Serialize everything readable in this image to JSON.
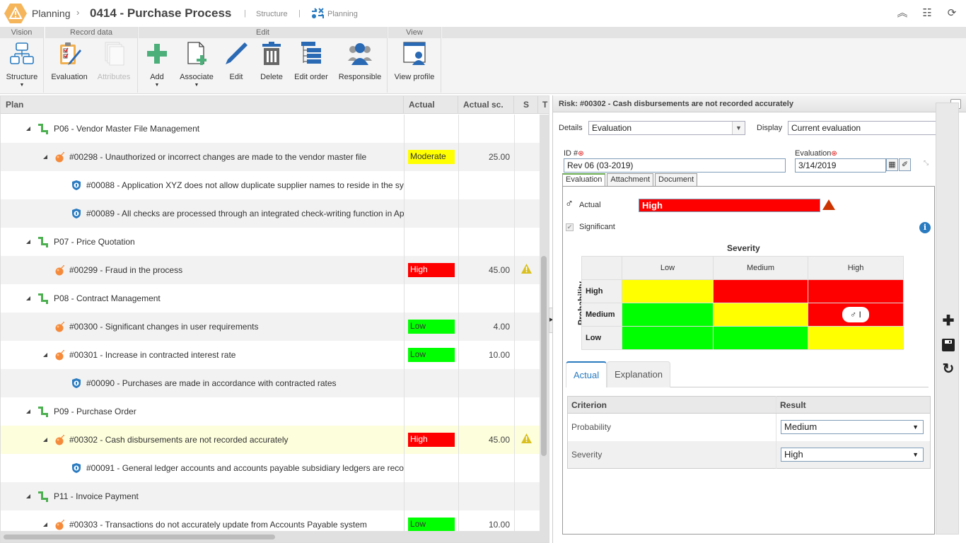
{
  "titlebar": {
    "breadcrumb_root": "Planning",
    "breadcrumb_sep": "›",
    "title": "0414 - Purchase Process",
    "nav_structure": "Structure",
    "nav_planning": "Planning",
    "pipe": "|",
    "right_icons": [
      "collapse-up-icon",
      "list-icon",
      "refresh-icon"
    ]
  },
  "ribbon": {
    "groups": [
      {
        "title": "Vision",
        "buttons": [
          {
            "label": "Structure",
            "icon": "structure-icon",
            "has_menu": true
          }
        ]
      },
      {
        "title": "Record data",
        "buttons": [
          {
            "label": "Evaluation",
            "icon": "evaluation-clipboard-icon"
          },
          {
            "label": "Attributes",
            "icon": "attributes-icon",
            "disabled": true
          }
        ]
      },
      {
        "title": "Edit",
        "buttons": [
          {
            "label": "Add",
            "icon": "plus-icon",
            "has_menu": true
          },
          {
            "label": "Associate",
            "icon": "associate-document-icon",
            "has_menu": true
          },
          {
            "label": "Edit",
            "icon": "pencil-icon"
          },
          {
            "label": "Delete",
            "icon": "trash-icon"
          },
          {
            "label": "Edit order",
            "icon": "edit-order-icon"
          },
          {
            "label": "Responsible",
            "icon": "users-icon"
          }
        ]
      },
      {
        "title": "View",
        "buttons": [
          {
            "label": "View profile",
            "icon": "view-profile-icon"
          }
        ]
      }
    ],
    "caret": "▼"
  },
  "grid": {
    "columns": [
      "Plan",
      "Actual",
      "Actual sc.",
      "S",
      "T"
    ],
    "rows": [
      {
        "type": "process",
        "level": 1,
        "expanded": true,
        "text": "P06 - Vendor Master File Management"
      },
      {
        "type": "risk",
        "level": 2,
        "expanded": true,
        "text": "#00298 - Unauthorized or incorrect changes are made to the vendor master file",
        "actual": "Moderate",
        "actual_color": "#ffff00",
        "actual_text_color": "#333333",
        "score": "25.00"
      },
      {
        "type": "control",
        "level": 3,
        "text": "#00088 - Application XYZ does not allow duplicate supplier names to reside in the sy"
      },
      {
        "type": "control",
        "level": 3,
        "text": "#00089 - All checks are processed through an integrated check-writing function in Ap"
      },
      {
        "type": "process",
        "level": 1,
        "expanded": true,
        "text": "P07 - Price Quotation"
      },
      {
        "type": "risk",
        "level": 2,
        "expanded": false,
        "text": "#00299 - Fraud in the process",
        "actual": "High",
        "actual_color": "#ff0000",
        "actual_text_color": "#ffffff",
        "score": "45.00",
        "warning": true
      },
      {
        "type": "process",
        "level": 1,
        "expanded": true,
        "text": "P08 - Contract Management"
      },
      {
        "type": "risk",
        "level": 2,
        "expanded": false,
        "text": "#00300 - Significant changes in user requirements",
        "actual": "Low",
        "actual_color": "#00ff00",
        "actual_text_color": "#333333",
        "score": "4.00"
      },
      {
        "type": "risk",
        "level": 2,
        "expanded": true,
        "text": "#00301 - Increase in contracted interest rate",
        "actual": "Low",
        "actual_color": "#00ff00",
        "actual_text_color": "#333333",
        "score": "10.00"
      },
      {
        "type": "control",
        "level": 3,
        "text": "#00090 - Purchases are made in accordance with contracted rates"
      },
      {
        "type": "process",
        "level": 1,
        "expanded": true,
        "text": "P09 - Purchase Order"
      },
      {
        "type": "risk",
        "level": 2,
        "expanded": true,
        "selected": true,
        "text": "#00302 - Cash disbursements are not recorded accurately",
        "actual": "High",
        "actual_color": "#ff0000",
        "actual_text_color": "#ffffff",
        "score": "45.00",
        "warning": true
      },
      {
        "type": "control",
        "level": 3,
        "text": "#00091 - General ledger accounts and accounts payable subsidiary ledgers are reco"
      },
      {
        "type": "process",
        "level": 1,
        "expanded": true,
        "text": "P11 - Invoice Payment"
      },
      {
        "type": "risk",
        "level": 2,
        "expanded": true,
        "text": "#00303 - Transactions do not accurately update from Accounts Payable system",
        "actual": "Low",
        "actual_color": "#00ff00",
        "actual_text_color": "#333333",
        "score": "10.00"
      }
    ]
  },
  "panel": {
    "title": "Risk: #00302 - Cash disbursements are not recorded accurately",
    "collapse_label": "»",
    "details_label": "Details",
    "details_value": "Evaluation",
    "display_label": "Display",
    "display_value": "Current evaluation",
    "id_label": "ID #",
    "id_value": "Rev 06 (03-2019)",
    "evaluation_label": "Evaluation",
    "evaluation_value": "3/14/2019",
    "required_mark": "⊛",
    "form_tabs": [
      "Evaluation",
      "Attachment",
      "Document"
    ],
    "actual_label": "Actual",
    "actual_value": "High",
    "actual_color": "#ff0000",
    "significant_label": "Significant",
    "significant_checked": true,
    "info": "i",
    "matrix": {
      "title": "Severity",
      "y_label": "Probability",
      "columns": [
        "Low",
        "Medium",
        "High"
      ],
      "rows": [
        {
          "label": "High",
          "colors": [
            "#ffff00",
            "#ff0000",
            "#ff0000"
          ]
        },
        {
          "label": "Medium",
          "colors": [
            "#00ff00",
            "#ffff00",
            "#ff0000"
          ]
        },
        {
          "label": "Low",
          "colors": [
            "#00ff00",
            "#00ff00",
            "#ffff00"
          ]
        }
      ],
      "marker": {
        "row": "Medium",
        "column": "High",
        "label": "I"
      }
    },
    "sub_tabs": [
      "Actual",
      "Explanation"
    ],
    "criteria_headers": [
      "Criterion",
      "Result"
    ],
    "criteria": [
      {
        "criterion": "Probability",
        "result": "Medium"
      },
      {
        "criterion": "Severity",
        "result": "High"
      }
    ],
    "side_actions": [
      "add-icon",
      "save-icon",
      "undo-icon"
    ]
  }
}
